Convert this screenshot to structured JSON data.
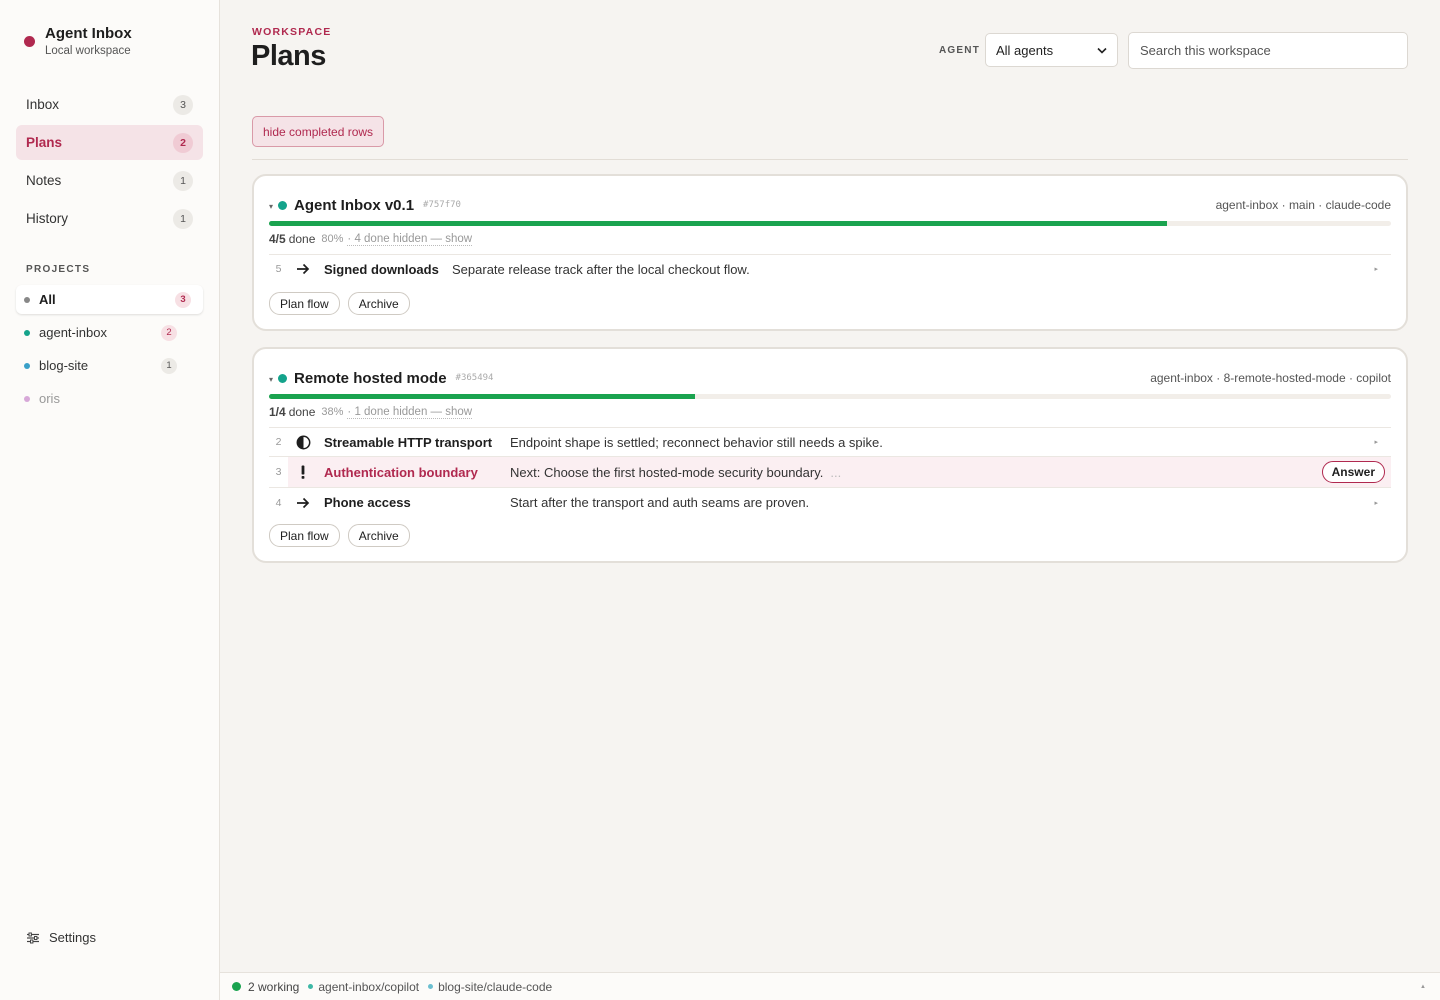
{
  "app": {
    "title": "Agent Inbox",
    "subtitle": "Local workspace",
    "brand_color": "#b0294f"
  },
  "nav": [
    {
      "label": "Inbox",
      "count": "3"
    },
    {
      "label": "Plans",
      "count": "2",
      "active": true
    },
    {
      "label": "Notes",
      "count": "1"
    },
    {
      "label": "History",
      "count": "1"
    }
  ],
  "projects": {
    "heading": "PROJECTS",
    "items": [
      {
        "label": "All",
        "count": "3",
        "color": "#888888",
        "active": true
      },
      {
        "label": "agent-inbox",
        "count": "2",
        "color": "#14a38b"
      },
      {
        "label": "blog-site",
        "count": "1",
        "color": "#3aa0c8"
      },
      {
        "label": "oris",
        "color": "#d7a8d8"
      }
    ]
  },
  "settings": {
    "label": "Settings"
  },
  "header": {
    "eyebrow": "WORKSPACE",
    "title": "Plans",
    "agent_label": "AGENT",
    "agent_value": "All agents",
    "search_placeholder": "Search this workspace"
  },
  "filter": {
    "hide_completed_label": "hide completed rows"
  },
  "plans": [
    {
      "title": "Agent Inbox v0.1",
      "hash": "#757f70",
      "meta": "agent-inbox · main · claude-code",
      "done": "4/5",
      "done_suffix": "done",
      "progress": 0.8,
      "pct": "80%",
      "hidden": "· 4 done hidden — show",
      "rows": [
        {
          "num": "5",
          "icon": "arrow-right-icon",
          "title": "Signed downloads",
          "desc": "Separate release track after the local checkout flow."
        }
      ],
      "actions": [
        "Plan flow",
        "Archive"
      ]
    },
    {
      "title": "Remote hosted mode",
      "hash": "#365494",
      "meta": "agent-inbox · 8-remote-hosted-mode · copilot",
      "done": "1/4",
      "done_suffix": "done",
      "progress": 0.38,
      "pct": "38%",
      "hidden": "· 1 done hidden — show",
      "rows": [
        {
          "num": "2",
          "icon": "half-circle-icon",
          "title": "Streamable HTTP transport",
          "desc": "Endpoint shape is settled; reconnect behavior still needs a spike."
        },
        {
          "num": "3",
          "icon": "exclamation-icon",
          "title": "Authentication boundary",
          "desc": "Next: Choose the first hosted-mode security boundary.",
          "ellipsis": "...",
          "action": "Answer"
        },
        {
          "num": "4",
          "icon": "arrow-right-icon",
          "title": "Phone access",
          "desc": "Start after the transport and auth seams are proven."
        }
      ],
      "actions": [
        "Plan flow",
        "Archive"
      ]
    }
  ],
  "footer": {
    "working": "2 working",
    "sessions": [
      "agent-inbox/copilot",
      "blog-site/claude-code"
    ]
  }
}
